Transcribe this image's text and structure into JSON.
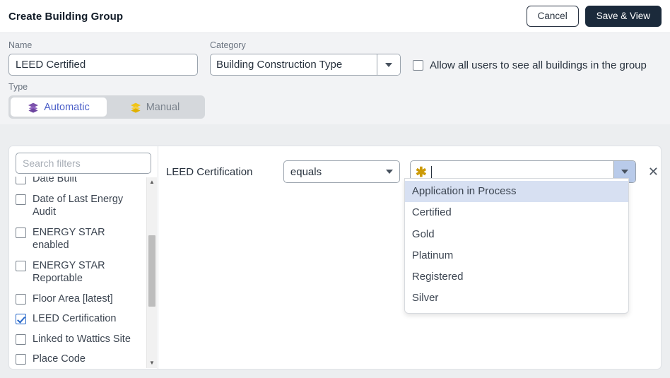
{
  "header": {
    "title": "Create Building Group",
    "cancel_label": "Cancel",
    "save_label": "Save & View"
  },
  "form": {
    "name_label": "Name",
    "name_value": "LEED Certified",
    "name_placeholder": "",
    "category_label": "Category",
    "category_value": "Building Construction Type",
    "allow_all_label": "Allow all users to see all buildings in the group",
    "allow_all_checked": false,
    "type_label": "Type",
    "tabs": [
      {
        "label": "Automatic",
        "icon": "layers-icon",
        "icon_color": "#7b52ab",
        "active": true
      },
      {
        "label": "Manual",
        "icon": "layers-icon",
        "icon_color": "#f0c419",
        "active": false
      }
    ]
  },
  "sidebar": {
    "search_placeholder": "Search filters",
    "search_value": "",
    "filters": [
      {
        "label": "Date Built",
        "checked": false
      },
      {
        "label": "Date of Last Energy Audit",
        "checked": false
      },
      {
        "label": "ENERGY STAR enabled",
        "checked": false
      },
      {
        "label": "ENERGY STAR Reportable",
        "checked": false
      },
      {
        "label": "Floor Area [latest]",
        "checked": false
      },
      {
        "label": "LEED Certification",
        "checked": true
      },
      {
        "label": "Linked to Wattics Site",
        "checked": false
      },
      {
        "label": "Place Code",
        "checked": false
      }
    ],
    "scroll_up_icon": "triangle-up-icon",
    "scroll_down_icon": "triangle-down-icon"
  },
  "rule": {
    "field_name": "LEED Certification",
    "operator": "equals",
    "value_text": "",
    "value_icon": "asterisk-icon",
    "remove_label": "✕",
    "options": [
      {
        "label": "Application in Process",
        "highlighted": true
      },
      {
        "label": "Certified",
        "highlighted": false
      },
      {
        "label": "Gold",
        "highlighted": false
      },
      {
        "label": "Platinum",
        "highlighted": false
      },
      {
        "label": "Registered",
        "highlighted": false
      },
      {
        "label": "Silver",
        "highlighted": false
      }
    ]
  },
  "colors": {
    "primary_button": "#1b2a3b",
    "accent_blue": "#4a5ec8",
    "checkbox_checked": "#2667c9",
    "asterisk_gold": "#cc9a06",
    "highlight_row": "#d7e0f2"
  }
}
